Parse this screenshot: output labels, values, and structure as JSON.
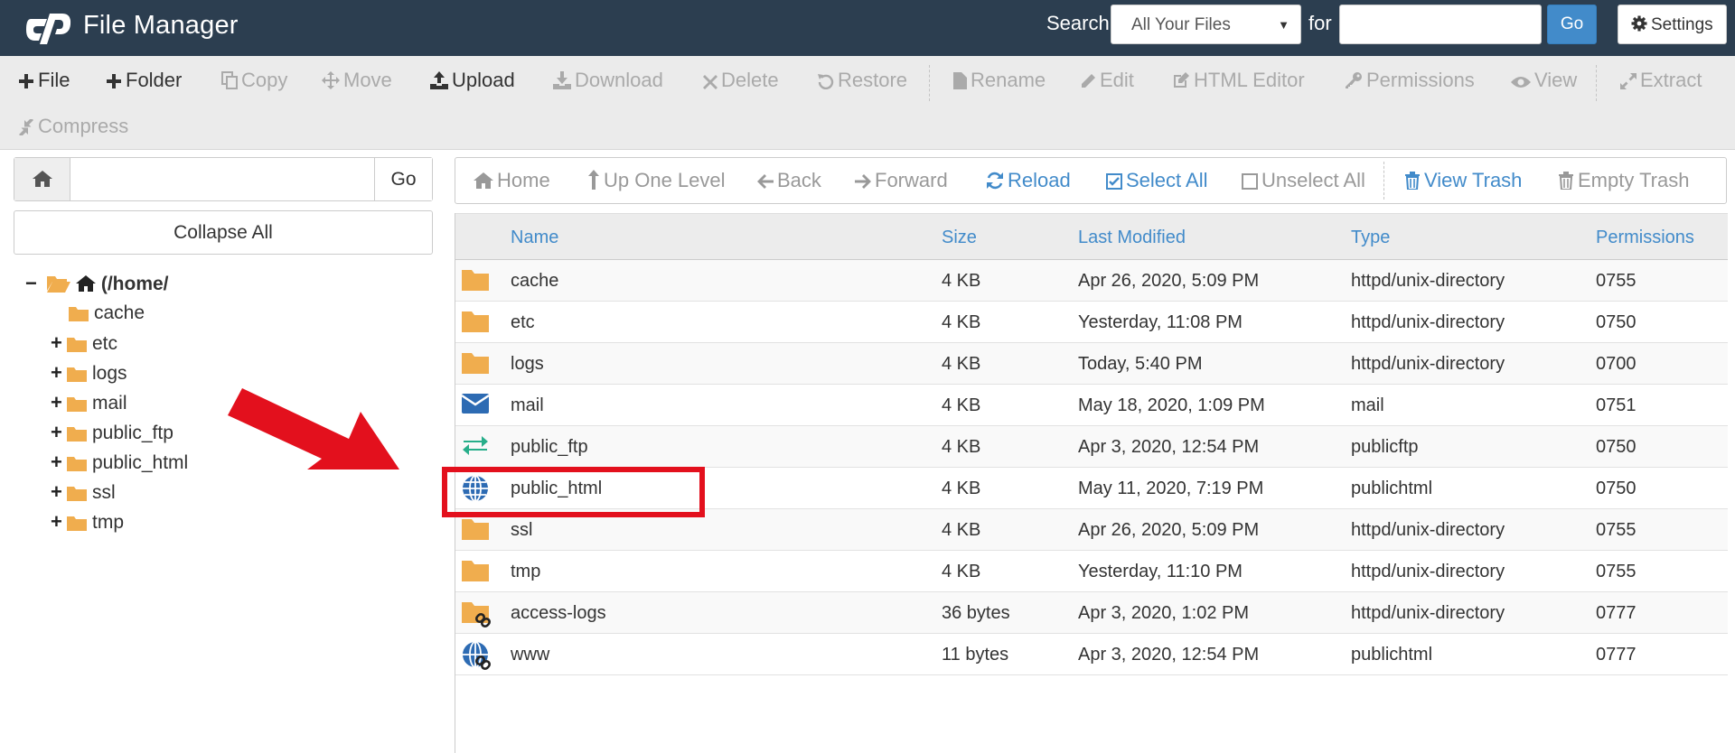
{
  "header": {
    "title": "File Manager",
    "search_label": "Search",
    "search_scope": "All Your Files",
    "for_label": "for",
    "search_value": "",
    "go_label": "Go",
    "settings_label": "Settings"
  },
  "toolbar": {
    "file": "File",
    "folder": "Folder",
    "copy": "Copy",
    "move": "Move",
    "upload": "Upload",
    "download": "Download",
    "delete": "Delete",
    "restore": "Restore",
    "rename": "Rename",
    "edit": "Edit",
    "html_editor": "HTML Editor",
    "permissions": "Permissions",
    "view": "View",
    "extract": "Extract",
    "compress": "Compress"
  },
  "tree": {
    "path_value": "",
    "go_label": "Go",
    "collapse_label": "Collapse All",
    "root_label": "(/home/",
    "items": [
      {
        "label": "cache",
        "toggle": ""
      },
      {
        "label": "etc",
        "toggle": "+"
      },
      {
        "label": "logs",
        "toggle": "+"
      },
      {
        "label": "mail",
        "toggle": "+"
      },
      {
        "label": "public_ftp",
        "toggle": "+"
      },
      {
        "label": "public_html",
        "toggle": "+"
      },
      {
        "label": "ssl",
        "toggle": "+"
      },
      {
        "label": "tmp",
        "toggle": "+"
      }
    ]
  },
  "nav": {
    "home": "Home",
    "up_one_level": "Up One Level",
    "back": "Back",
    "forward": "Forward",
    "reload": "Reload",
    "select_all": "Select All",
    "unselect_all": "Unselect All",
    "view_trash": "View Trash",
    "empty_trash": "Empty Trash"
  },
  "table": {
    "columns": [
      "Name",
      "Size",
      "Last Modified",
      "Type",
      "Permissions"
    ],
    "rows": [
      {
        "icon": "folder-icon",
        "name": "cache",
        "size": "4 KB",
        "modified": "Apr 26, 2020, 5:09 PM",
        "type": "httpd/unix-directory",
        "perms": "0755"
      },
      {
        "icon": "folder-icon",
        "name": "etc",
        "size": "4 KB",
        "modified": "Yesterday, 11:08 PM",
        "type": "httpd/unix-directory",
        "perms": "0750"
      },
      {
        "icon": "folder-icon",
        "name": "logs",
        "size": "4 KB",
        "modified": "Today, 5:40 PM",
        "type": "httpd/unix-directory",
        "perms": "0700"
      },
      {
        "icon": "envelope-icon",
        "name": "mail",
        "size": "4 KB",
        "modified": "May 18, 2020, 1:09 PM",
        "type": "mail",
        "perms": "0751"
      },
      {
        "icon": "exchange-arrows-icon",
        "name": "public_ftp",
        "size": "4 KB",
        "modified": "Apr 3, 2020, 12:54 PM",
        "type": "publicftp",
        "perms": "0750"
      },
      {
        "icon": "globe-icon",
        "name": "public_html",
        "size": "4 KB",
        "modified": "May 11, 2020, 7:19 PM",
        "type": "publichtml",
        "perms": "0750"
      },
      {
        "icon": "folder-icon",
        "name": "ssl",
        "size": "4 KB",
        "modified": "Apr 26, 2020, 5:09 PM",
        "type": "httpd/unix-directory",
        "perms": "0755"
      },
      {
        "icon": "folder-icon",
        "name": "tmp",
        "size": "4 KB",
        "modified": "Yesterday, 11:10 PM",
        "type": "httpd/unix-directory",
        "perms": "0755"
      },
      {
        "icon": "folder-link-icon",
        "name": "access-logs",
        "size": "36 bytes",
        "modified": "Apr 3, 2020, 1:02 PM",
        "type": "httpd/unix-directory",
        "perms": "0777"
      },
      {
        "icon": "globe-link-icon",
        "name": "www",
        "size": "11 bytes",
        "modified": "Apr 3, 2020, 12:54 PM",
        "type": "publichtml",
        "perms": "0777"
      }
    ]
  },
  "colors": {
    "header_bg": "#2c3e50",
    "accent_blue": "#428bca",
    "folder": "#f0ad4e",
    "annotation_red": "#e3101d"
  }
}
